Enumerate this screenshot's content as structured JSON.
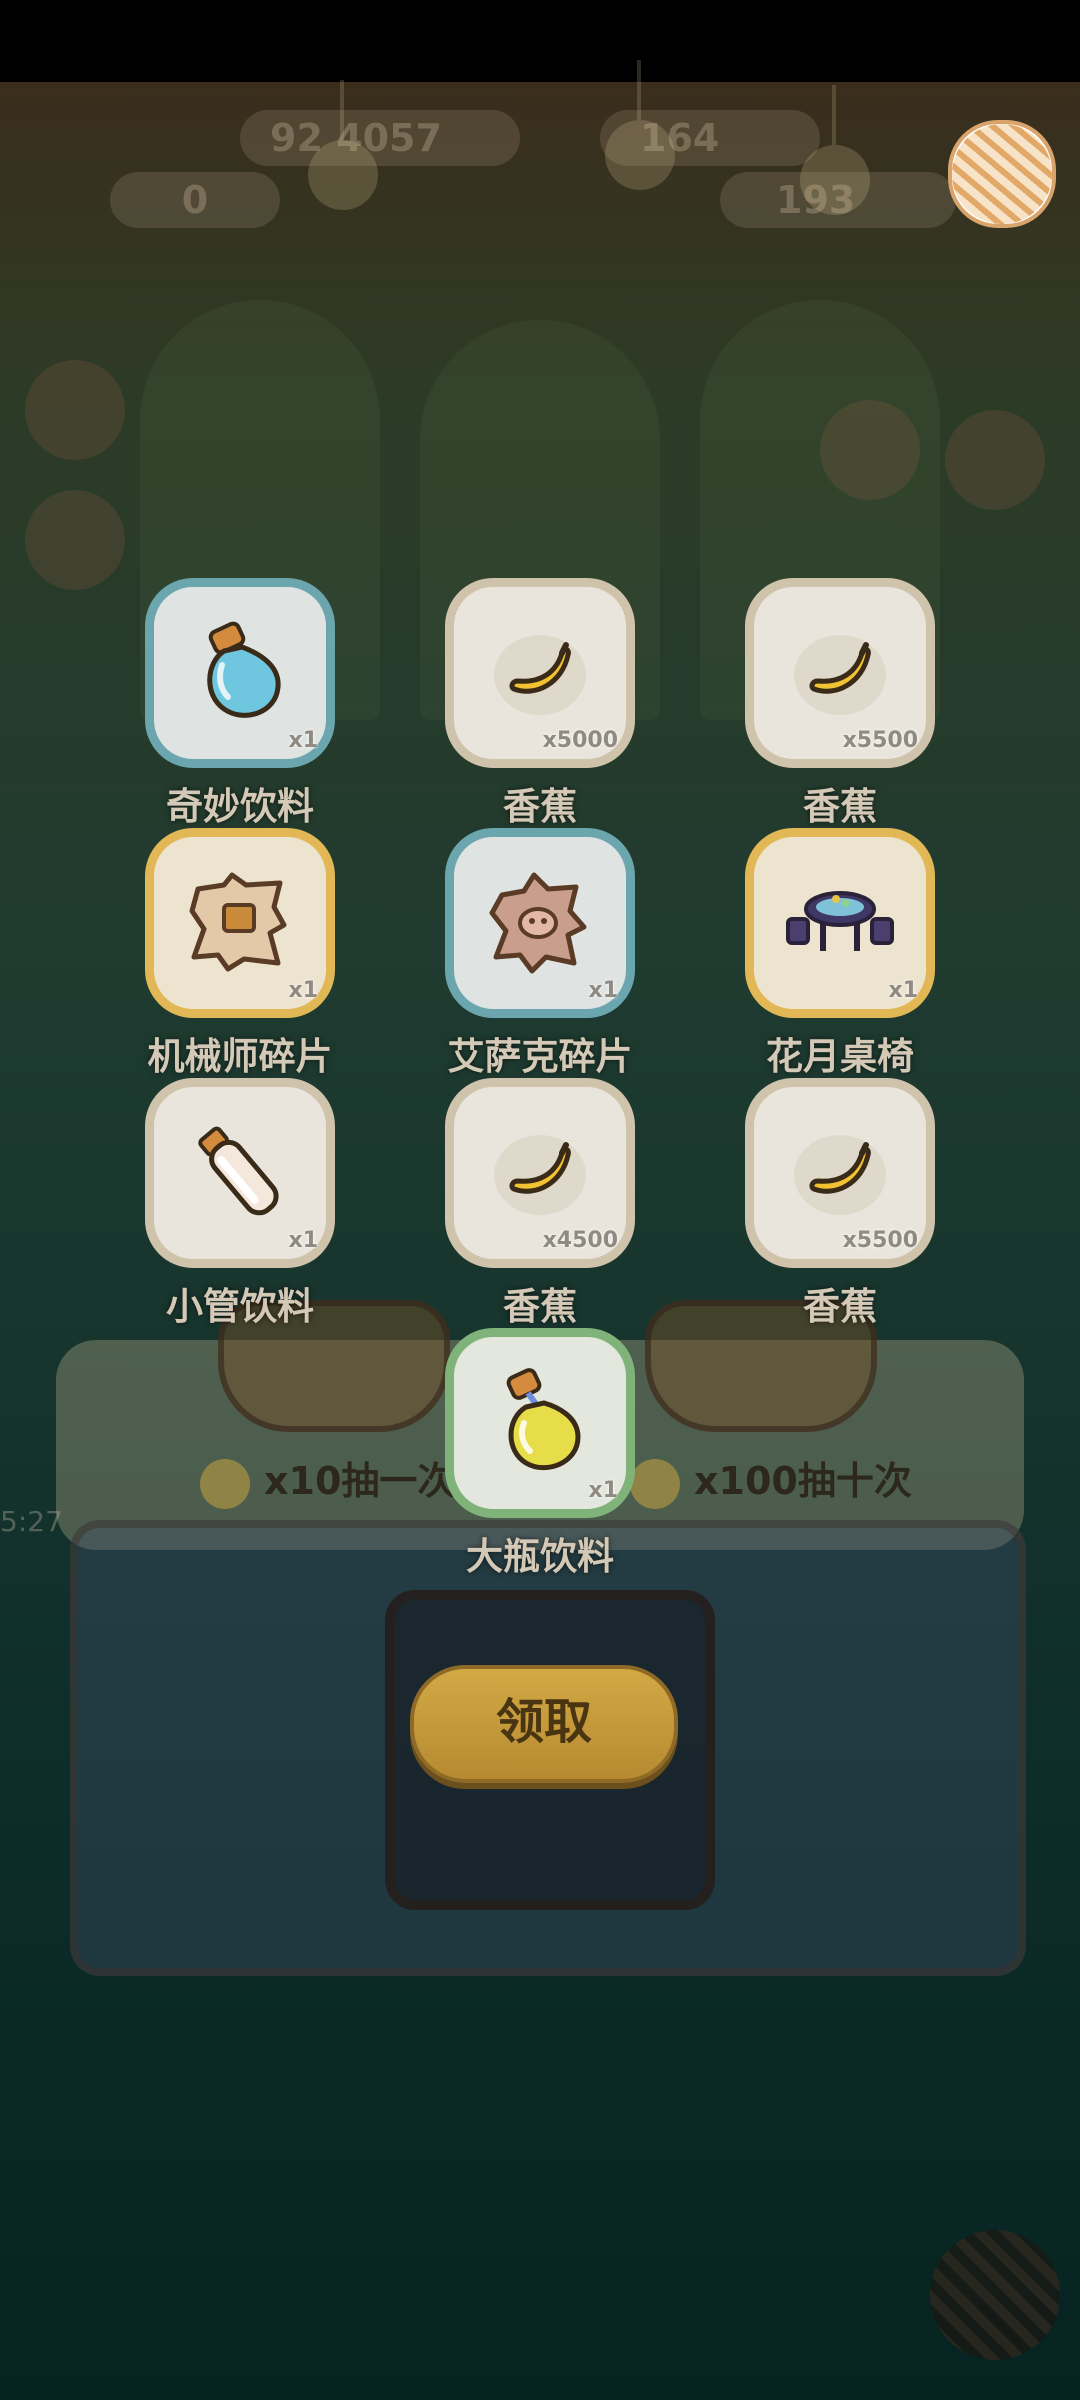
{
  "hud": {
    "currency_1": "92",
    "currency_2": "4057",
    "currency_3": "164",
    "counter_left": "0",
    "counter_right": "19",
    "counter_right_tail": "3",
    "side_clock": "5:27"
  },
  "yarn_button_icon": "yarn-ball-icon",
  "rewards": [
    {
      "name": "奇妙饮料",
      "qty": "x1",
      "frame": "teal",
      "icon": "potion-bottle-icon"
    },
    {
      "name": "香蕉",
      "qty": "x5000",
      "frame": "white",
      "icon": "banana-icon"
    },
    {
      "name": "香蕉",
      "qty": "x5500",
      "frame": "white",
      "icon": "banana-icon"
    },
    {
      "name": "机械师碎片",
      "qty": "x1",
      "frame": "gold",
      "icon": "mechanic-fragment-icon"
    },
    {
      "name": "艾萨克碎片",
      "qty": "x1",
      "frame": "teal",
      "icon": "isaac-fragment-icon"
    },
    {
      "name": "花月桌椅",
      "qty": "x1",
      "frame": "gold",
      "icon": "table-chairs-icon"
    },
    {
      "name": "小管饮料",
      "qty": "x1",
      "frame": "white",
      "icon": "tube-drink-icon"
    },
    {
      "name": "香蕉",
      "qty": "x4500",
      "frame": "white",
      "icon": "banana-icon"
    },
    {
      "name": "香蕉",
      "qty": "x5500",
      "frame": "white",
      "icon": "banana-icon"
    },
    {
      "name": "大瓶饮料",
      "qty": "x1",
      "frame": "green",
      "icon": "large-bottle-icon"
    }
  ],
  "draw_options": {
    "single": "x10抽一次",
    "ten": "x100抽十次"
  },
  "claim_label": "领取",
  "colors": {
    "claim_button": "#c79b3a",
    "tile_teal": "#6ba6ae",
    "tile_gold": "#e2b756",
    "tile_green": "#7fb37a",
    "tile_white": "#cfc3ac"
  }
}
